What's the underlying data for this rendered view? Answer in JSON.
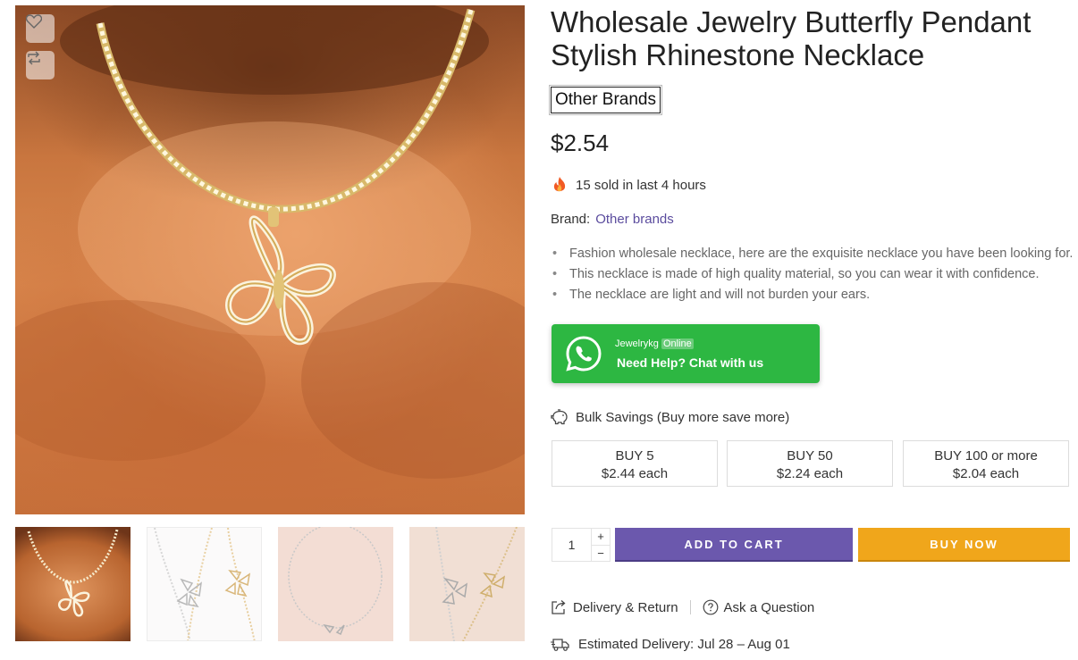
{
  "product": {
    "title": "Wholesale Jewelry Butterfly Pendant Stylish Rhinestone Necklace",
    "brand_tag": "Other Brands",
    "price": "$2.54",
    "sold_text": "15 sold in last 4 hours",
    "brand_label": "Brand:",
    "brand_value": "Other brands",
    "bullets": [
      "Fashion wholesale necklace, here are the exquisite necklace you have been looking for.",
      "This necklace is made of high quality material, so you can wear it with confidence.",
      "The necklace are light and will not burden your ears."
    ]
  },
  "whatsapp": {
    "name": "Jewelrykg",
    "status": "Online",
    "cta": "Need Help? Chat with us"
  },
  "bulk": {
    "heading": "Bulk Savings (Buy more save more)",
    "tiers": [
      {
        "qty": "BUY 5",
        "price": "$2.44 each"
      },
      {
        "qty": "BUY 50",
        "price": "$2.24 each"
      },
      {
        "qty": "BUY 100 or more",
        "price": "$2.04 each"
      }
    ]
  },
  "cart": {
    "quantity": "1",
    "plus": "+",
    "minus": "−",
    "add_to_cart": "ADD TO CART",
    "buy_now": "BUY NOW"
  },
  "links": {
    "delivery_return": "Delivery & Return",
    "ask_question": "Ask a Question",
    "estimated_delivery": "Estimated Delivery: Jul 28 – Aug 01"
  },
  "icons": {
    "wishlist": "heart-icon",
    "compare": "compare-icon",
    "fire": "fire-icon",
    "whatsapp": "whatsapp-icon",
    "bulk": "piggy-bank-icon",
    "delivery": "share-box-icon",
    "question": "question-circle-icon",
    "truck": "truck-icon"
  },
  "colors": {
    "accent_purple": "#6b58ad",
    "buy_orange": "#f0a61b",
    "whatsapp_green": "#2db742",
    "brand_link": "#5b4c9e"
  }
}
